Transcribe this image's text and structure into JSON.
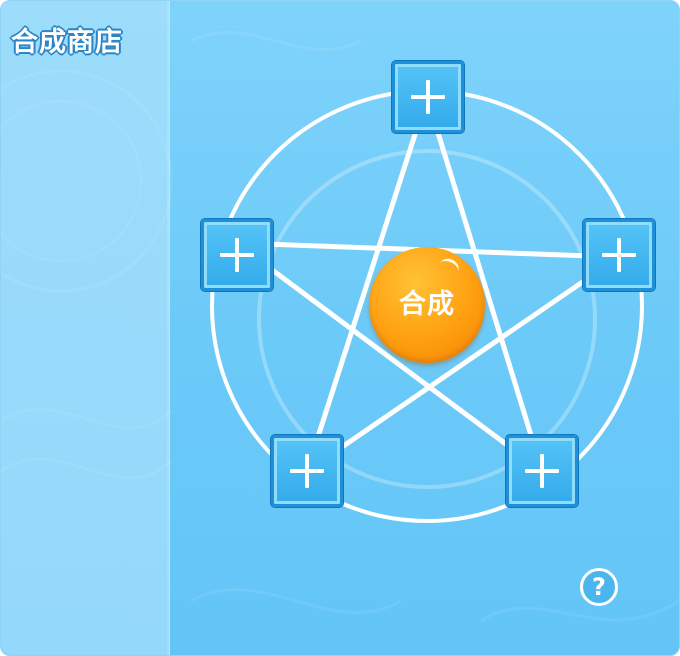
{
  "window": {
    "title": "合成商店"
  },
  "synthesis": {
    "button_label": "合成",
    "slots": [
      {
        "name": "top",
        "icon": "plus-icon"
      },
      {
        "name": "left",
        "icon": "plus-icon"
      },
      {
        "name": "right",
        "icon": "plus-icon"
      },
      {
        "name": "bottom-left",
        "icon": "plus-icon"
      },
      {
        "name": "bottom-right",
        "icon": "plus-icon"
      }
    ]
  },
  "help": {
    "icon": "question-mark-icon",
    "label": "?"
  },
  "colors": {
    "panel_bg": "#6ccaf8",
    "sidebar_bg": "#9ddcfb",
    "slot_border": "#1e8fd8",
    "button_orange": "#ff9f10",
    "line_white": "#ffffff"
  }
}
